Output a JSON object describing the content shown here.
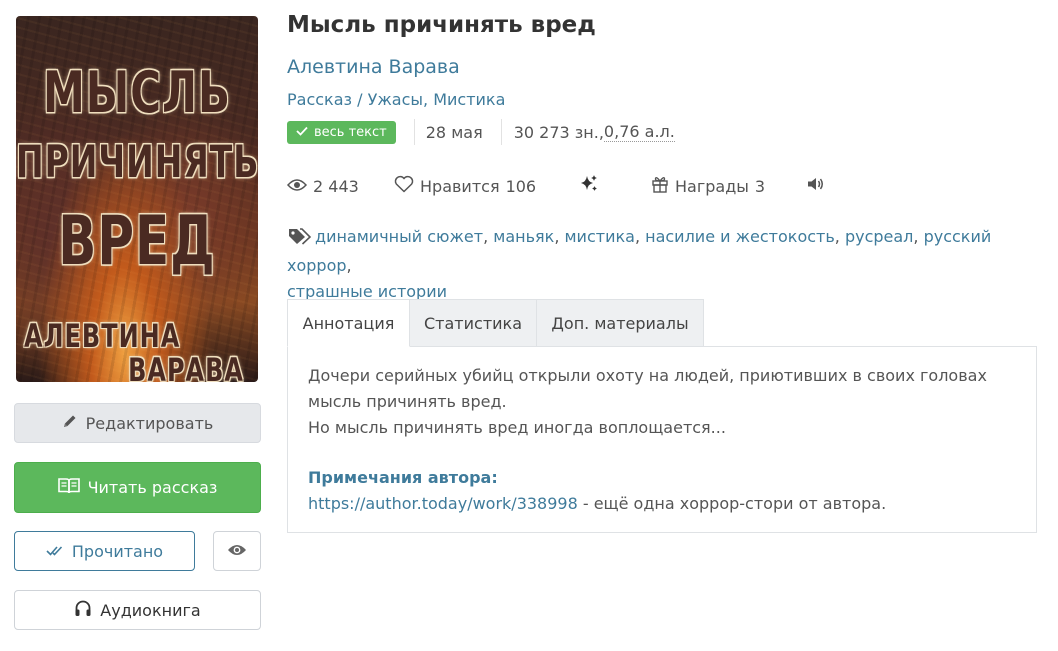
{
  "book": {
    "cover": {
      "line1": "МЫСЛЬ",
      "line2": "ПРИЧИНЯТЬ",
      "line3": "ВРЕД",
      "line4": "АЛЕВТИНА",
      "line5": "ВАРАВА"
    },
    "title": "Мысль причинять вред",
    "author": "Алевтина Варава",
    "genres": [
      "Рассказ",
      "/",
      "Ужасы",
      ",",
      "Мистика"
    ],
    "status_badge": "весь текст",
    "date": "28 мая",
    "size_chars": "30 273 зн., ",
    "size_al": "0,76 а.л."
  },
  "stats": {
    "views": "2 443",
    "likes_label": "Нравится",
    "likes_count": "106",
    "awards_label": "Награды",
    "awards_count": "3"
  },
  "tags": [
    "динамичный сюжет",
    "маньяк",
    "мистика",
    "насилие и жестокость",
    "русреал",
    "русский хоррор",
    "страшные истории"
  ],
  "tabs": [
    {
      "label": "Аннотация"
    },
    {
      "label": "Статистика"
    },
    {
      "label": "Доп. материалы"
    }
  ],
  "annotation": {
    "text1": "Дочери серийных убийц открыли охоту на людей, приютивших в своих головах мысль причинять вред.",
    "text2": "Но мысль причинять вред иногда воплощается...",
    "notes_title": "Примечания автора:",
    "notes_link": "https://author.today/work/338998",
    "notes_rest": " - ещё одна хоррор-стори от автора."
  },
  "buttons": {
    "edit": "Редактировать",
    "read": "Читать рассказ",
    "done": "Прочитано",
    "audio": "Аудиокнига"
  },
  "colors": {
    "link": "#3f7b9b",
    "green": "#5cb85c",
    "muted_button": "#e6e8eb"
  },
  "icons": [
    "pencil-icon",
    "open-book-icon",
    "double-check-icon",
    "eye-icon",
    "headphones-icon",
    "checkmark-icon",
    "heart-icon",
    "sparkles-icon",
    "gift-icon",
    "speaker-icon",
    "tags-icon"
  ]
}
